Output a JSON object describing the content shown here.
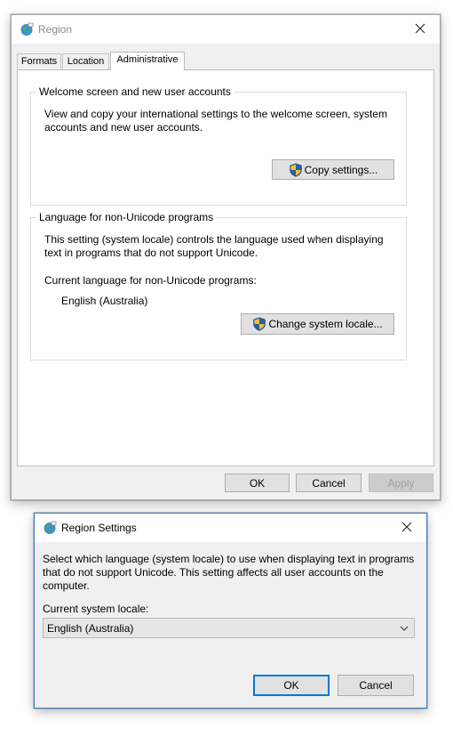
{
  "region_window": {
    "title": "Region",
    "tabs": [
      "Formats",
      "Location",
      "Administrative"
    ],
    "active_tab": "Administrative",
    "welcome_group": {
      "legend": "Welcome screen and new user accounts",
      "description_line1": "View and copy your international settings to the welcome screen, system",
      "description_line2": "accounts and new user accounts.",
      "copy_button": "Copy settings..."
    },
    "language_group": {
      "legend": "Language for non-Unicode programs",
      "description_line1": "This setting (system locale) controls the language used when displaying",
      "description_line2": "text in programs that do not support Unicode.",
      "current_label": "Current language for non-Unicode programs:",
      "current_value": "English (Australia)",
      "change_button": "Change system locale..."
    },
    "buttons": {
      "ok": "OK",
      "cancel": "Cancel",
      "apply": "Apply"
    }
  },
  "region_settings_dialog": {
    "title": "Region Settings",
    "description_line1": "Select which language (system locale) to use when displaying text in programs",
    "description_line2": "that do not support Unicode. This setting affects all user accounts on the",
    "description_line3": "computer.",
    "locale_label": "Current system locale:",
    "locale_value": "English (Australia)",
    "buttons": {
      "ok": "OK",
      "cancel": "Cancel"
    }
  },
  "icons": {
    "title": "globe-icon",
    "close": "close-icon",
    "uac": "uac-shield-icon",
    "dropdown": "chevron-down-icon"
  },
  "colors": {
    "window_bg": "#f0f0f0",
    "panel_bg": "#ffffff",
    "button_bg": "#e1e1e1",
    "default_button_border": "#0078d7",
    "dialog_border": "#3c7fc4"
  }
}
